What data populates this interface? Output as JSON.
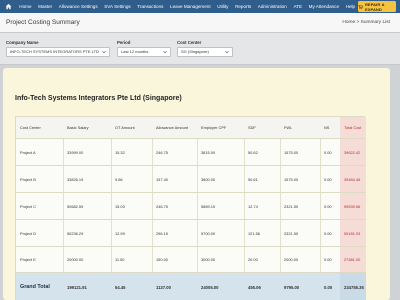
{
  "nav": {
    "items": [
      "Home",
      "Master",
      "Allowance Settings",
      "SVA Settings",
      "Transactions",
      "Leave Management",
      "Utility",
      "Reports",
      "Administration",
      "ATE",
      "My Attendance",
      "Help"
    ],
    "logout": "Log Out",
    "logo_text": "REPAIR & EXPAND"
  },
  "header": {
    "title": "Project Costing Summary",
    "breadcrumb": "Home > Summary List"
  },
  "filters": {
    "company_label": "Company Name",
    "company_value": "INFO-TECH SYSTEMS INTEGRATORS PTE LTD",
    "period_label": "Period",
    "period_value": "Last 12 months",
    "cost_center_label": "Cost Center",
    "cost_center_value": "SG (Singapore)"
  },
  "report": {
    "company_title": "Info-Tech Systems Integrators Pte Ltd (Singapore)",
    "columns": [
      "Cost Center",
      "Basic Salary",
      "OT Amount",
      "Allowance Amount",
      "Employer CPF",
      "SDF",
      "FWL",
      "NS",
      "Total Cost"
    ],
    "rows": [
      [
        "Project A",
        "33999.00",
        "15.32",
        "246.75",
        "3815.00",
        "50.62",
        "1575.00",
        "0.00",
        "39622.42"
      ],
      [
        "Project B",
        "33826.19",
        "9.66",
        "197.40",
        "3800.00",
        "50.61",
        "1575.00",
        "0.00",
        "39484.46"
      ],
      [
        "Project C",
        "50682.59",
        "15.03",
        "246.75",
        "5689.15",
        "12.74",
        "2321.50",
        "0.00",
        "59539.56"
      ],
      [
        "Project D",
        "50236.29",
        "12.99",
        "296.15",
        "5700.00",
        "121.56",
        "2321.50",
        "0.00",
        "59181.93"
      ],
      [
        "Project E",
        "20000.00",
        "11.50",
        "150.00",
        "3000.00",
        "20.00",
        "2000.00",
        "0.00",
        "27381.00"
      ]
    ],
    "grand_total_label": "Grand Total",
    "grand_total": [
      "199121.91",
      "54.45",
      "1137.00",
      "24005.00",
      "455.06",
      "9795.00",
      "0.00",
      "234755.35"
    ]
  },
  "colors": {
    "navbar": "#2f5d8c",
    "accent_orange": "#f5a623",
    "card_bg": "#f9f6dc",
    "total_cost_bg": "#f6dcd6",
    "grand_total_bg": "#d4e3ec"
  }
}
